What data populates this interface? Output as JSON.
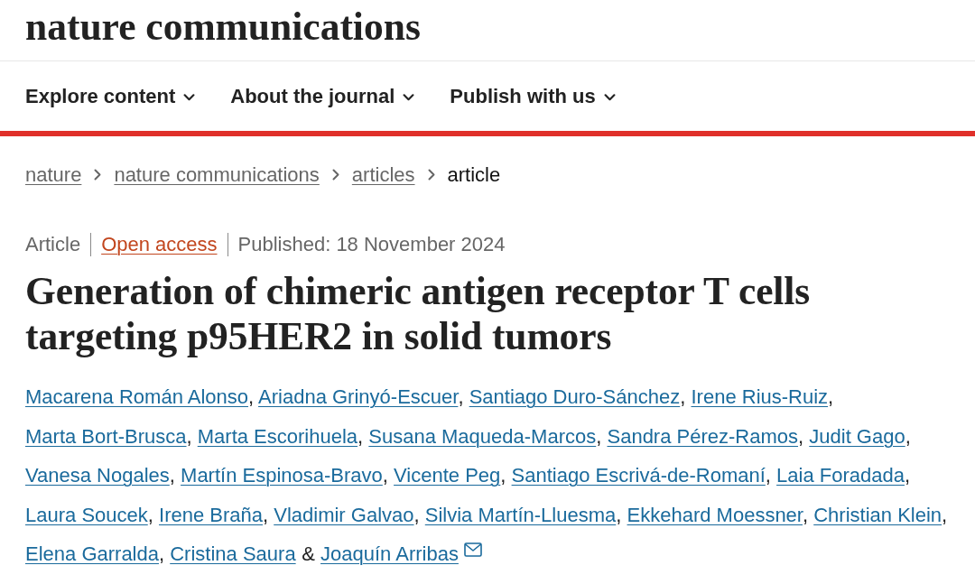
{
  "logo": "nature communications",
  "nav": [
    {
      "label": "Explore content"
    },
    {
      "label": "About the journal"
    },
    {
      "label": "Publish with us"
    }
  ],
  "breadcrumbs": [
    {
      "label": "nature",
      "current": false
    },
    {
      "label": "nature communications",
      "current": false
    },
    {
      "label": "articles",
      "current": false
    },
    {
      "label": "article",
      "current": true
    }
  ],
  "article_meta": {
    "type": "Article",
    "access": "Open access",
    "published": "Published: 18 November 2024"
  },
  "title": "Generation of chimeric antigen receptor T cells targeting p95HER2 in solid tumors",
  "authors": [
    {
      "name": "Macarena Román Alonso",
      "comma": ",",
      "corresponding": false
    },
    {
      "name": "Ariadna Grinyó-Escuer",
      "comma": ",",
      "corresponding": false
    },
    {
      "name": "Santiago Duro-Sánchez",
      "comma": ",",
      "corresponding": false
    },
    {
      "name": "Irene Rius-Ruiz",
      "comma": ",",
      "corresponding": false
    },
    {
      "name": "Marta Bort-Brusca",
      "comma": ",",
      "corresponding": false
    },
    {
      "name": "Marta Escorihuela",
      "comma": ",",
      "corresponding": false
    },
    {
      "name": "Susana Maqueda-Marcos",
      "comma": ",",
      "corresponding": false
    },
    {
      "name": "Sandra Pérez-Ramos",
      "comma": ",",
      "corresponding": false
    },
    {
      "name": "Judit Gago",
      "comma": ",",
      "corresponding": false
    },
    {
      "name": "Vanesa Nogales",
      "comma": ",",
      "corresponding": false
    },
    {
      "name": "Martín Espinosa-Bravo",
      "comma": ",",
      "corresponding": false
    },
    {
      "name": "Vicente Peg",
      "comma": ",",
      "corresponding": false
    },
    {
      "name": "Santiago Escrivá-de-Romaní",
      "comma": ",",
      "corresponding": false
    },
    {
      "name": "Laia Foradada",
      "comma": ",",
      "corresponding": false
    },
    {
      "name": "Laura Soucek",
      "comma": ",",
      "corresponding": false
    },
    {
      "name": "Irene Braña",
      "comma": ",",
      "corresponding": false
    },
    {
      "name": "Vladimir Galvao",
      "comma": ",",
      "corresponding": false
    },
    {
      "name": "Silvia Martín-Lluesma",
      "comma": ",",
      "corresponding": false
    },
    {
      "name": "Ekkehard Moessner",
      "comma": ",",
      "corresponding": false
    },
    {
      "name": "Christian Klein",
      "comma": ",",
      "corresponding": false
    },
    {
      "name": "Elena Garralda",
      "comma": ",",
      "corresponding": false
    },
    {
      "name": "Cristina Saura",
      "conjunction": "&",
      "corresponding": false
    },
    {
      "name": "Joaquín Arribas",
      "corresponding": true
    }
  ]
}
